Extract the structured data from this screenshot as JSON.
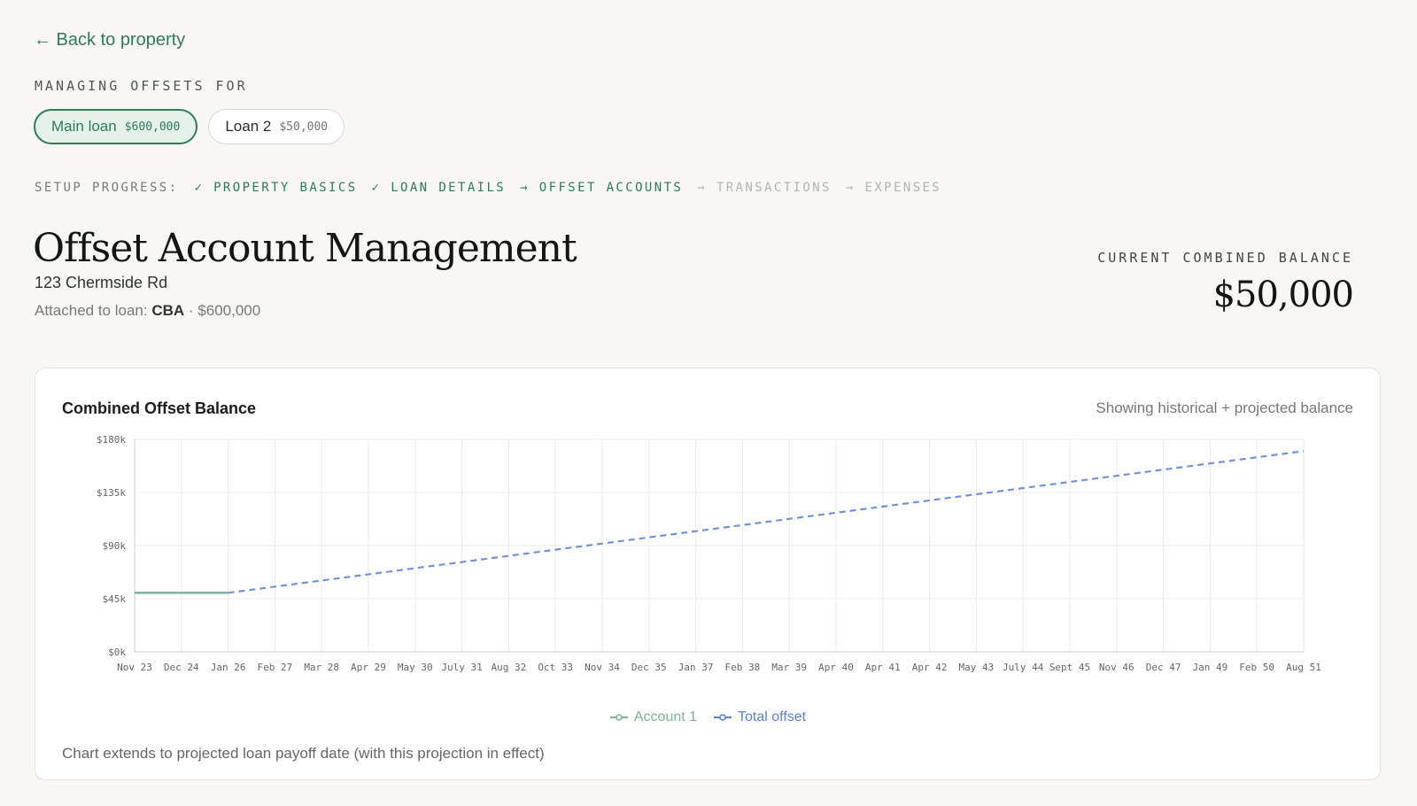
{
  "nav": {
    "back_label": "← Back to property"
  },
  "managing": {
    "label": "MANAGING OFFSETS FOR",
    "loans": [
      {
        "name": "Main loan",
        "amount": "$600,000",
        "active": true
      },
      {
        "name": "Loan 2",
        "amount": "$50,000",
        "active": false
      }
    ]
  },
  "progress": {
    "label": "SETUP PROGRESS:",
    "steps": [
      {
        "text": "✓ PROPERTY BASICS",
        "state": "done"
      },
      {
        "text": "✓ LOAN DETAILS",
        "state": "done"
      },
      {
        "text": "→ OFFSET ACCOUNTS",
        "state": "current"
      },
      {
        "text": "→ TRANSACTIONS",
        "state": "future"
      },
      {
        "text": "→ EXPENSES",
        "state": "future"
      }
    ]
  },
  "header": {
    "title": "Offset Account Management",
    "address": "123 Chermside Rd",
    "attached_prefix": "Attached to loan:",
    "attached_bank": "CBA",
    "attached_amount": "· $600,000",
    "balance_label": "CURRENT COMBINED BALANCE",
    "balance_value": "$50,000"
  },
  "card": {
    "title": "Combined Offset Balance",
    "note": "Showing historical + projected balance",
    "footnote": "Chart extends to projected loan payoff date (with this projection in effect)"
  },
  "colors": {
    "accent": "#2f7d55",
    "account1": "#7fb396",
    "total": "#5b7fd6"
  },
  "chart_data": {
    "type": "line",
    "title": "Combined Offset Balance",
    "ylim": [
      0,
      180000
    ],
    "y_ticks": [
      0,
      45000,
      90000,
      135000,
      180000
    ],
    "y_tick_labels": [
      "$0k",
      "$45k",
      "$90k",
      "$135k",
      "$180k"
    ],
    "x_tick_labels": [
      "Nov 23",
      "Dec 24",
      "Jan 26",
      "Feb 27",
      "Mar 28",
      "Apr 29",
      "May 30",
      "July 31",
      "Aug 32",
      "Oct 33",
      "Nov 34",
      "Dec 35",
      "Jan 37",
      "Feb 38",
      "Mar 39",
      "Apr 40",
      "Apr 41",
      "Apr 42",
      "May 43",
      "July 44",
      "Sept 45",
      "Nov 46",
      "Dec 47",
      "Jan 49",
      "Feb 50",
      "Aug 51"
    ],
    "grid": true,
    "legend_position": "bottom",
    "series": [
      {
        "name": "Account 1",
        "style": "solid",
        "x": [
          "Nov 23",
          "Jan 26"
        ],
        "values": [
          50000,
          50000
        ]
      },
      {
        "name": "Total offset",
        "style": "dashed",
        "x": [
          "Nov 23",
          "Jan 26",
          "Aug 51"
        ],
        "values": [
          50000,
          50000,
          170000
        ]
      }
    ]
  }
}
